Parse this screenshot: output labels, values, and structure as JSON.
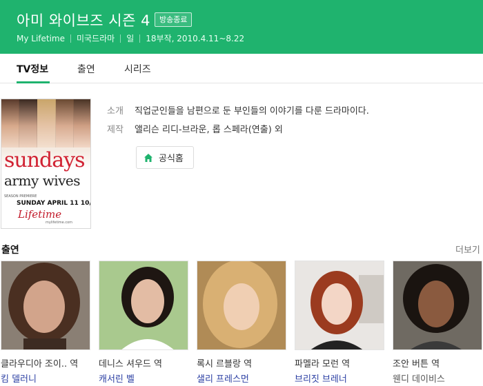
{
  "header": {
    "title": "아미 와이브즈 시즌 4",
    "status_badge": "방송종료",
    "meta": [
      "My Lifetime",
      "미국드라마",
      "일",
      "18부작, 2010.4.11~8.22"
    ],
    "background_color": "#1fb36e"
  },
  "tabs": [
    {
      "label": "TV정보",
      "active": true
    },
    {
      "label": "출연",
      "active": false
    },
    {
      "label": "시리즈",
      "active": false
    }
  ],
  "poster": {
    "headline": "sundays",
    "subtitle": "army wives",
    "season_text": "SEASON PREMIERE",
    "air_date": "SUNDAY APRIL 11 10/9c",
    "network_logo": "Lifetime",
    "url": "mylifetime.com"
  },
  "info": {
    "intro_label": "소개",
    "intro_value": "직업군인들을 남편으로 둔 부인들의 이야기를 다룬 드라마이다.",
    "credit_label": "제작",
    "credit_value": "앨리슨 리디-브라운, 롭 스페라(연출) 외",
    "homepage_label": "공식홈",
    "homepage_icon": "home-icon"
  },
  "cast": {
    "title": "출연",
    "more_label": "더보기",
    "members": [
      {
        "role": "클라우디아 조이.. 역",
        "actor": "킴 델러니"
      },
      {
        "role": "데니스 셔우드 역",
        "actor": "캐서린 벨"
      },
      {
        "role": "록시 르블랑 역",
        "actor": "샐리 프레스먼"
      },
      {
        "role": "파멜라 모런 역",
        "actor": "브리짓 브레너"
      },
      {
        "role": "조안 버튼 역",
        "actor": "웬디 데이비스"
      }
    ]
  }
}
